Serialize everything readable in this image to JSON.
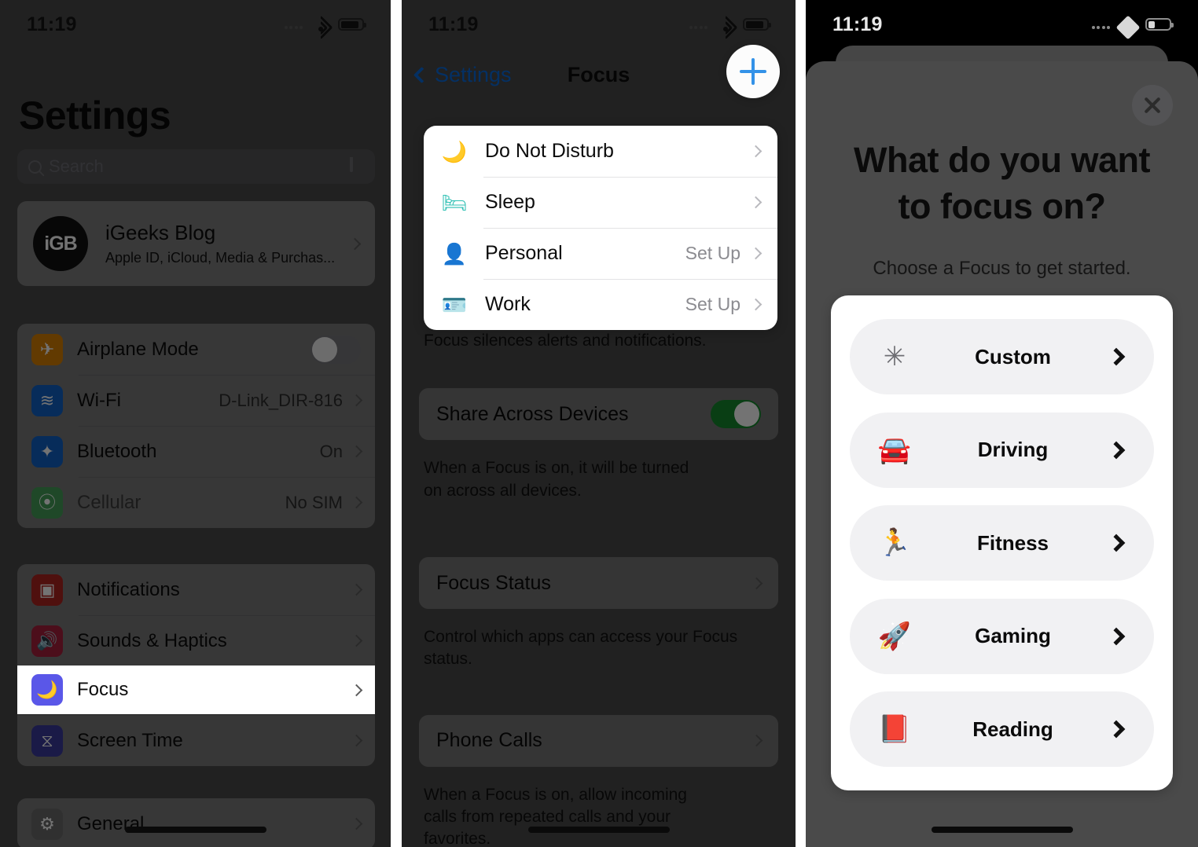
{
  "status_bar": {
    "time": "11:19"
  },
  "panel1": {
    "title": "Settings",
    "search": {
      "placeholder": "Search"
    },
    "account": {
      "initials": "iGB",
      "name": "iGeeks Blog",
      "subtitle": "Apple ID, iCloud, Media & Purchas..."
    },
    "group1": [
      {
        "label": "Airplane Mode",
        "value": "",
        "control": "toggle",
        "toggle_on": false,
        "icon": "airplane-icon",
        "icon_color": "#d98003"
      },
      {
        "label": "Wi-Fi",
        "value": "D-Link_DIR-816",
        "control": "chevron",
        "icon": "wifi-icon",
        "icon_color": "#1063c8"
      },
      {
        "label": "Bluetooth",
        "value": "On",
        "control": "chevron",
        "icon": "bluetooth-icon",
        "icon_color": "#1063c8"
      },
      {
        "label": "Cellular",
        "value": "No SIM",
        "control": "chevron",
        "icon": "cellular-icon",
        "icon_color": "#45a15a"
      }
    ],
    "group2": [
      {
        "label": "Notifications",
        "value": "",
        "control": "chevron",
        "icon": "notifications-icon",
        "icon_color": "#b0241f"
      },
      {
        "label": "Sounds & Haptics",
        "value": "",
        "control": "chevron",
        "icon": "sounds-icon",
        "icon_color": "#a8213c"
      },
      {
        "label": "Focus",
        "value": "",
        "control": "chevron",
        "icon": "moon-icon",
        "icon_color": "#5a57e8",
        "highlighted": true
      },
      {
        "label": "Screen Time",
        "value": "",
        "control": "chevron",
        "icon": "hourglass-icon",
        "icon_color": "#3b3b9e"
      }
    ],
    "group3": [
      {
        "label": "General",
        "value": "",
        "control": "chevron",
        "icon": "gear-icon",
        "icon_color": "#6b6b6b"
      }
    ]
  },
  "panel2": {
    "nav": {
      "back_label": "Settings",
      "title": "Focus",
      "add_label": "+"
    },
    "focus_list": [
      {
        "label": "Do Not Disturb",
        "value": "",
        "icon": "moon-icon",
        "icon_color": "#5a57e8"
      },
      {
        "label": "Sleep",
        "value": "",
        "icon": "bed-icon",
        "icon_color": "#2cbfb3"
      },
      {
        "label": "Personal",
        "value": "Set Up",
        "icon": "person-icon",
        "icon_color": "#b04ad8"
      },
      {
        "label": "Work",
        "value": "Set Up",
        "icon": "badge-icon",
        "icon_color": "#2eb8e0"
      }
    ],
    "focus_note": "Focus silences alerts and notifications.",
    "share": {
      "label": "Share Across Devices",
      "toggle_on": true,
      "note": "When a Focus is on, it will be turned on across all devices."
    },
    "focus_status": {
      "label": "Focus Status",
      "note": "Control which apps can access your Focus status."
    },
    "phone_calls": {
      "label": "Phone Calls",
      "note": "When a Focus is on, allow incoming calls from repeated calls and your favorites."
    }
  },
  "panel3": {
    "close_label": "Close",
    "title": "What do you want to focus on?",
    "subtitle": "Choose a Focus to get started.",
    "choices": [
      {
        "label": "Custom",
        "icon": "sparkle-wand-icon",
        "icon_color": "#6e6e73"
      },
      {
        "label": "Driving",
        "icon": "car-icon",
        "icon_color": "#4a47d6"
      },
      {
        "label": "Fitness",
        "icon": "running-person-icon",
        "icon_color": "#2cc24a"
      },
      {
        "label": "Gaming",
        "icon": "rocket-icon",
        "icon_color": "#1577e6"
      },
      {
        "label": "Reading",
        "icon": "book-icon",
        "icon_color": "#f59000"
      }
    ]
  },
  "colors": {
    "dim_overlay": "#4a4a4a",
    "accent_blue": "#0a6cdd",
    "toggle_green": "#15892e",
    "card_white": "#ffffff"
  }
}
